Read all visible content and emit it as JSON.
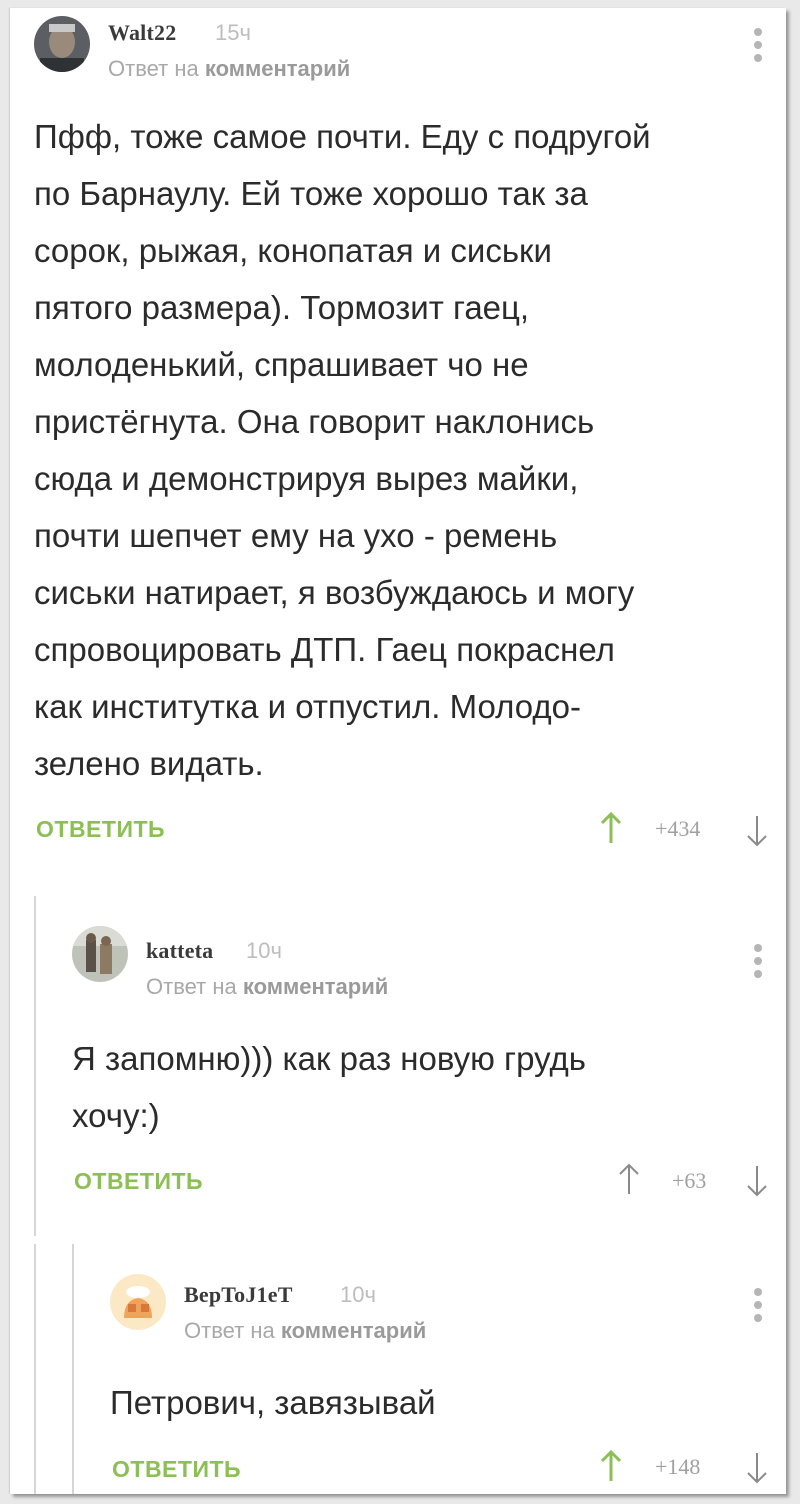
{
  "colors": {
    "accent": "#8cbf55",
    "text": "#2b2b2b",
    "muted": "#a8a8a8"
  },
  "icons": {
    "up": "arrow-up-icon",
    "down": "arrow-down-icon",
    "menu": "more-vertical-icon"
  },
  "comments": [
    {
      "author": "Walt22",
      "time": "15ч",
      "reply_prefix": "Ответ на",
      "reply_target": "комментарий",
      "text": "Пфф, тоже самое почти. Еду с подругой\nпо Барнаулу. Ей тоже хорошо так за\nсорок, рыжая, конопатая и сиськи\nпятого размера). Тормозит гаец,\nмолоденький, спрашивает чо не\nпристёгнута. Она говорит наклонись\nсюда и демонстрируя вырез майки,\nпочти шепчет ему на ухо - ремень\nсиськи натирает, я возбуждаюсь и могу\nспровоцировать ДТП. Гаец покраснел\nкак институтка и отпустил. Молодо-\nзелено видать.",
      "reply_label": "ОТВЕТИТЬ",
      "score": "+434",
      "voted_up": true
    },
    {
      "author": "katteta",
      "time": "10ч",
      "reply_prefix": "Ответ на",
      "reply_target": "комментарий",
      "text": "Я запомню))) как раз новую грудь\nхочу:)",
      "reply_label": "ОТВЕТИТЬ",
      "score": "+63",
      "voted_up": false
    },
    {
      "author": "BepToJ1eT",
      "time": "10ч",
      "reply_prefix": "Ответ на",
      "reply_target": "комментарий",
      "text": "Петрович, завязывай",
      "reply_label": "ОТВЕТИТЬ",
      "score": "+148",
      "voted_up": true
    }
  ]
}
